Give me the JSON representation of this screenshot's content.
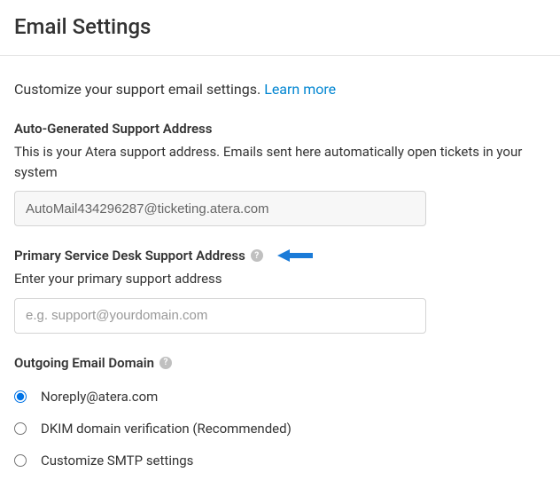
{
  "page_title": "Email Settings",
  "intro_text": "Customize your support email settings. ",
  "learn_more": "Learn more",
  "auto_gen": {
    "label": "Auto-Generated Support Address",
    "help": "This is your Atera support address. Emails sent here automatically open tickets in your system",
    "value": "AutoMail434296287@ticketing.atera.com"
  },
  "primary": {
    "label": "Primary Service Desk Support Address",
    "help": "Enter your primary support address",
    "placeholder": "e.g. support@yourdomain.com",
    "value": ""
  },
  "outgoing": {
    "label": "Outgoing Email Domain",
    "options": [
      "Noreply@atera.com",
      "DKIM domain verification (Recommended)",
      "Customize SMTP settings"
    ],
    "selected": 0
  },
  "colors": {
    "link": "#0085d1",
    "arrow": "#1b7bd8",
    "radio_accent": "#0073e6"
  }
}
